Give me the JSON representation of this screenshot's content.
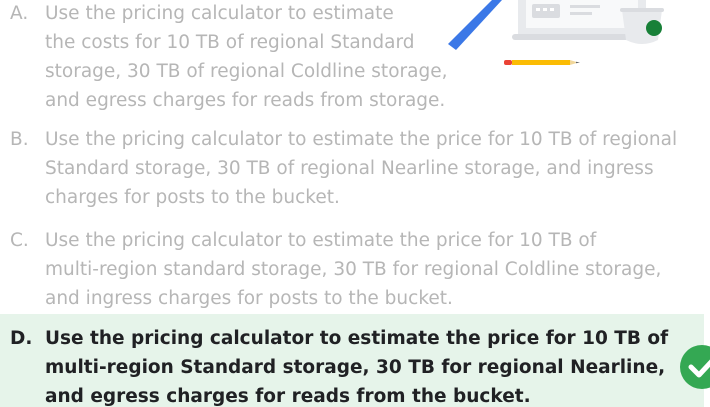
{
  "options": [
    {
      "letter": "A.",
      "lines": [
        "Use the pricing calculator to estimate",
        "the costs for 10 TB of regional Standard",
        "storage, 30 TB of regional Coldline storage,",
        "and egress charges for reads from storage."
      ],
      "selected": false
    },
    {
      "letter": "B.",
      "lines": [
        "Use the pricing calculator to estimate the price for 10 TB of regional",
        "Standard storage, 30 TB of regional Nearline storage, and ingress",
        "charges for posts to the bucket."
      ],
      "selected": false
    },
    {
      "letter": "C.",
      "lines": [
        "Use the pricing calculator to estimate the price for 10 TB of",
        "multi-region standard storage, 30 TB for regional Coldline storage,",
        "and ingress charges for posts to the bucket."
      ],
      "selected": false
    },
    {
      "letter": "D.",
      "lines": [
        "Use the pricing calculator to estimate the price for 10 TB of",
        "multi-region Standard storage, 30 TB for regional Nearline,",
        "and egress charges for reads from the bucket."
      ],
      "selected": true
    }
  ],
  "colors": {
    "correct_bg": "#e6f4ea",
    "correct_check": "#34a853",
    "muted_text": "#b6b6b6",
    "selected_text": "#202124"
  },
  "icons": {
    "correct": "check-circle-icon",
    "illustration": "laptop-pencil-illustration"
  }
}
